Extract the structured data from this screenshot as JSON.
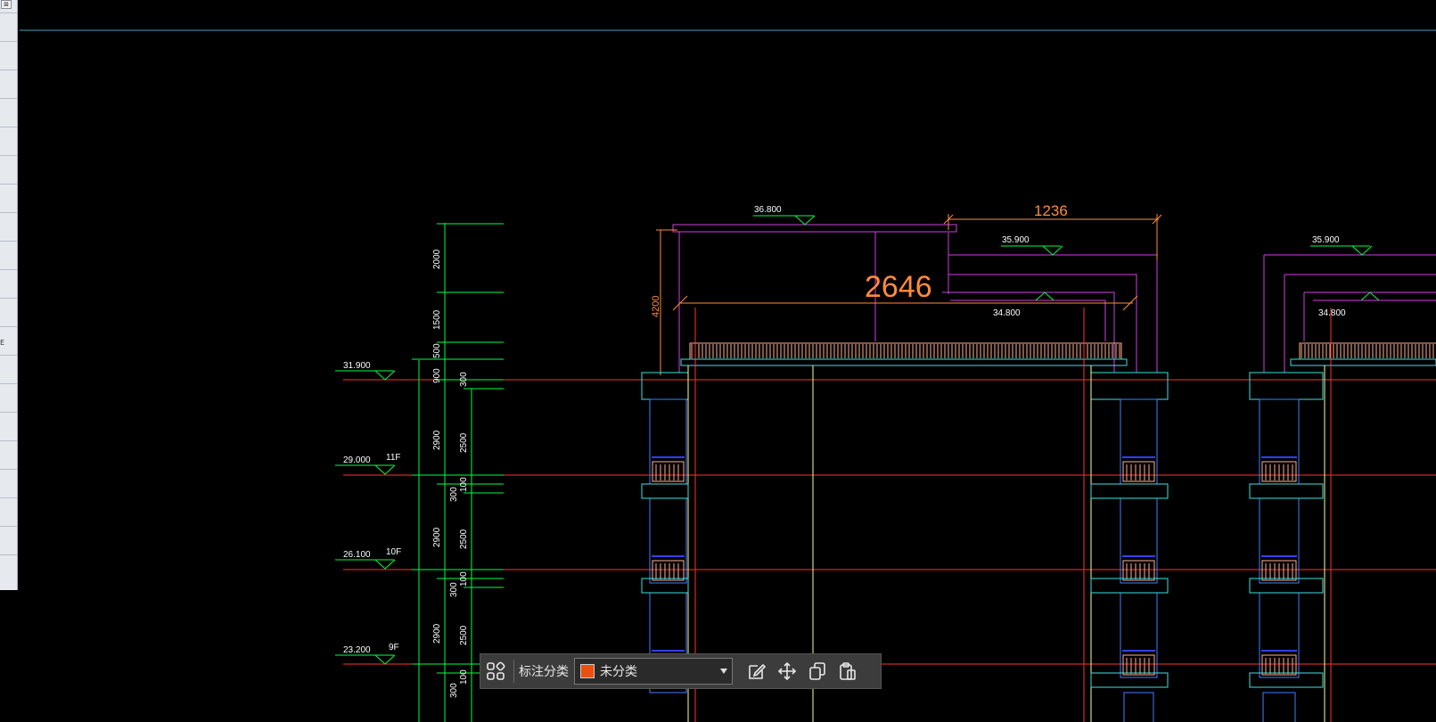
{
  "sidepanel": {
    "letter": "E",
    "close_glyph": "⊠"
  },
  "drawing": {
    "colors": {
      "background": "#000000",
      "level": "#ff3030",
      "axis": "#ffff80",
      "dim": "#00ff40",
      "parapet": "#d040e0",
      "cyan": "#40e0e0",
      "blue": "#4080ff",
      "orange": "#ff8c3c",
      "rail": "#ffb090",
      "white": "#ffffff"
    },
    "elevations": [
      {
        "value": "31.900",
        "floor": ""
      },
      {
        "value": "29.000",
        "floor": "11F"
      },
      {
        "value": "26.100",
        "floor": "10F"
      },
      {
        "value": "23.200",
        "floor": "9F"
      }
    ],
    "roof_elevations": {
      "top": "36.800",
      "mid_a": "35.900",
      "low_a": "34.800",
      "mid_b": "35.900",
      "low_b": "34.800"
    },
    "dims_outer": [
      "2000",
      "1500",
      "500",
      "900",
      "2900",
      "2900",
      "2900"
    ],
    "dims_inner": [
      "300",
      "2500",
      "100",
      "300",
      "2500",
      "100",
      "300",
      "2500",
      "100",
      "300"
    ],
    "dims_orange": {
      "top": "1236",
      "middle": "2646",
      "side": "4200"
    }
  },
  "toolbar": {
    "grid_icon": "grid-icon",
    "category_label": "标注分类",
    "category_value": "未分类",
    "category_color": "#e8510e",
    "edit_icon": "edit-icon",
    "move_icon": "move-icon",
    "copy_icon": "copy-icon",
    "paste_icon": "paste-icon"
  }
}
